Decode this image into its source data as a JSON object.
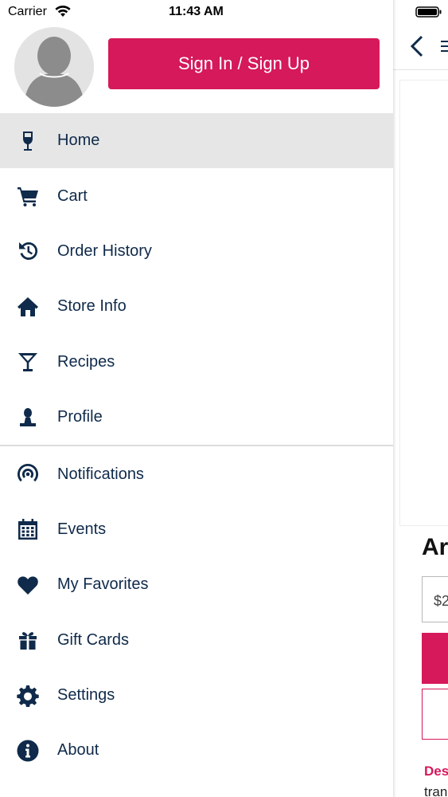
{
  "status_bar": {
    "carrier": "Carrier",
    "time": "11:43 AM"
  },
  "drawer": {
    "sign_in_label": "Sign In / Sign Up",
    "accent_color": "#d5195a",
    "text_color": "#0f2a4a",
    "menu_primary": [
      {
        "label": "Home",
        "icon": "wine-glass-icon",
        "active": true
      },
      {
        "label": "Cart",
        "icon": "cart-icon"
      },
      {
        "label": "Order History",
        "icon": "history-icon"
      },
      {
        "label": "Store Info",
        "icon": "house-icon"
      },
      {
        "label": "Recipes",
        "icon": "cocktail-icon"
      },
      {
        "label": "Profile",
        "icon": "person-icon"
      }
    ],
    "menu_secondary": [
      {
        "label": "Notifications",
        "icon": "broadcast-icon"
      },
      {
        "label": "Events",
        "icon": "calendar-icon"
      },
      {
        "label": "My Favorites",
        "icon": "heart-icon"
      },
      {
        "label": "Gift Cards",
        "icon": "gift-icon"
      },
      {
        "label": "Settings",
        "icon": "gear-icon"
      },
      {
        "label": "About",
        "icon": "info-icon"
      }
    ]
  },
  "background_page": {
    "title_partial": "Ar",
    "price_partial": "$2",
    "description_heading_partial": "Des",
    "description_text_partial": "tran"
  }
}
